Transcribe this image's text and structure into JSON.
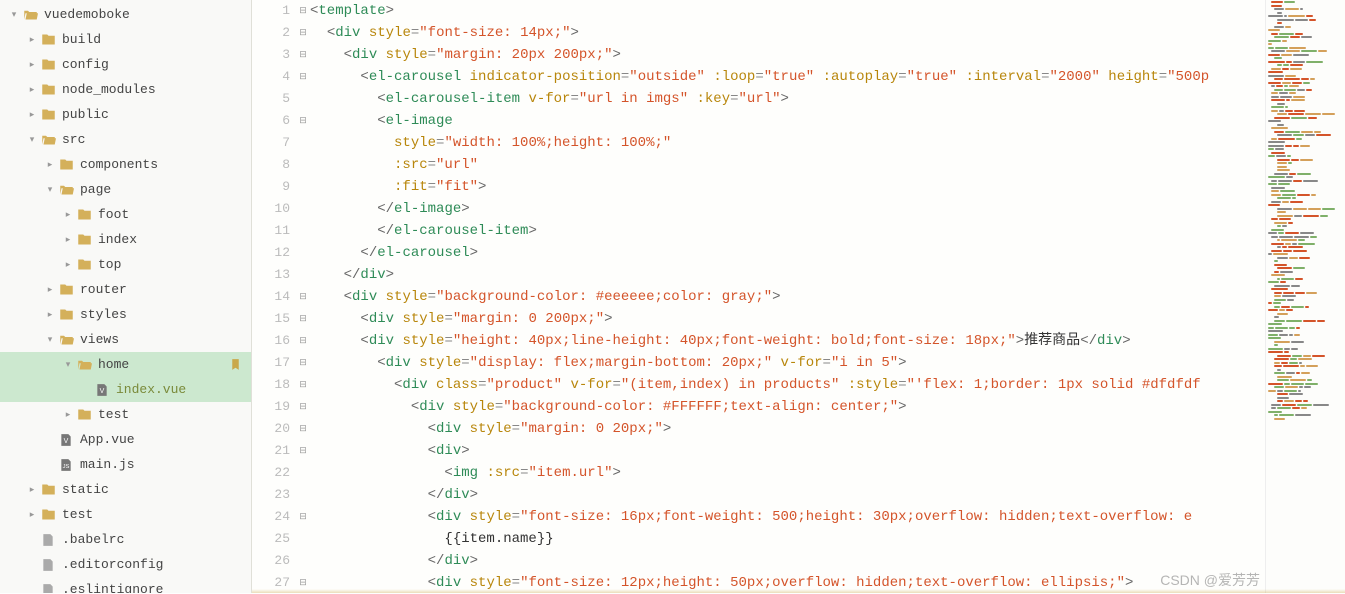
{
  "tree": [
    {
      "depth": 0,
      "chev": "down",
      "icon": "folder-open",
      "label": "vuedemoboke"
    },
    {
      "depth": 1,
      "chev": "right",
      "icon": "folder",
      "label": "build"
    },
    {
      "depth": 1,
      "chev": "right",
      "icon": "folder",
      "label": "config"
    },
    {
      "depth": 1,
      "chev": "right",
      "icon": "folder",
      "label": "node_modules"
    },
    {
      "depth": 1,
      "chev": "right",
      "icon": "folder",
      "label": "public"
    },
    {
      "depth": 1,
      "chev": "down",
      "icon": "folder-open",
      "label": "src"
    },
    {
      "depth": 2,
      "chev": "right",
      "icon": "folder",
      "label": "components"
    },
    {
      "depth": 2,
      "chev": "down",
      "icon": "folder-open",
      "label": "page"
    },
    {
      "depth": 3,
      "chev": "right",
      "icon": "folder",
      "label": "foot"
    },
    {
      "depth": 3,
      "chev": "right",
      "icon": "folder",
      "label": "index"
    },
    {
      "depth": 3,
      "chev": "right",
      "icon": "folder",
      "label": "top"
    },
    {
      "depth": 2,
      "chev": "right",
      "icon": "folder",
      "label": "router"
    },
    {
      "depth": 2,
      "chev": "right",
      "icon": "folder",
      "label": "styles"
    },
    {
      "depth": 2,
      "chev": "down",
      "icon": "folder-open",
      "label": "views"
    },
    {
      "depth": 3,
      "chev": "down",
      "icon": "folder-open",
      "label": "home",
      "mark": true,
      "selected": true
    },
    {
      "depth": 4,
      "chev": "",
      "icon": "file-v",
      "label": "index.vue",
      "selected": true,
      "filelabel": true
    },
    {
      "depth": 3,
      "chev": "right",
      "icon": "folder",
      "label": "test"
    },
    {
      "depth": 2,
      "chev": "",
      "icon": "file-v",
      "label": "App.vue"
    },
    {
      "depth": 2,
      "chev": "",
      "icon": "file-js",
      "label": "main.js"
    },
    {
      "depth": 1,
      "chev": "right",
      "icon": "folder",
      "label": "static"
    },
    {
      "depth": 1,
      "chev": "right",
      "icon": "folder",
      "label": "test"
    },
    {
      "depth": 1,
      "chev": "",
      "icon": "file-g",
      "label": ".babelrc"
    },
    {
      "depth": 1,
      "chev": "",
      "icon": "file-g",
      "label": ".editorconfig"
    },
    {
      "depth": 1,
      "chev": "",
      "icon": "file-g",
      "label": ".eslintignore"
    }
  ],
  "lines": [
    {
      "n": 1,
      "fold": "minus",
      "tokens": [
        [
          "punc",
          "<"
        ],
        [
          "tag",
          "template"
        ],
        [
          "punc",
          ">"
        ]
      ]
    },
    {
      "n": 2,
      "fold": "minus",
      "tokens": [
        [
          "txt",
          "  "
        ],
        [
          "punc",
          "<"
        ],
        [
          "tag",
          "div"
        ],
        [
          "txt",
          " "
        ],
        [
          "attr",
          "style"
        ],
        [
          "op",
          "="
        ],
        [
          "str",
          "\"font-size: 14px;\""
        ],
        [
          "punc",
          ">"
        ]
      ]
    },
    {
      "n": 3,
      "fold": "minus",
      "tokens": [
        [
          "txt",
          "    "
        ],
        [
          "punc",
          "<"
        ],
        [
          "tag",
          "div"
        ],
        [
          "txt",
          " "
        ],
        [
          "attr",
          "style"
        ],
        [
          "op",
          "="
        ],
        [
          "str",
          "\"margin: 20px 200px;\""
        ],
        [
          "punc",
          ">"
        ]
      ]
    },
    {
      "n": 4,
      "fold": "minus",
      "tokens": [
        [
          "txt",
          "      "
        ],
        [
          "punc",
          "<"
        ],
        [
          "tag",
          "el-carousel"
        ],
        [
          "txt",
          " "
        ],
        [
          "attr",
          "indicator-position"
        ],
        [
          "op",
          "="
        ],
        [
          "str",
          "\"outside\""
        ],
        [
          "txt",
          " "
        ],
        [
          "attr",
          ":loop"
        ],
        [
          "op",
          "="
        ],
        [
          "str",
          "\"true\""
        ],
        [
          "txt",
          " "
        ],
        [
          "attr",
          ":autoplay"
        ],
        [
          "op",
          "="
        ],
        [
          "str",
          "\"true\""
        ],
        [
          "txt",
          " "
        ],
        [
          "attr",
          ":interval"
        ],
        [
          "op",
          "="
        ],
        [
          "str",
          "\"2000\""
        ],
        [
          "txt",
          " "
        ],
        [
          "attr",
          "height"
        ],
        [
          "op",
          "="
        ],
        [
          "str",
          "\"500p"
        ]
      ]
    },
    {
      "n": 5,
      "fold": "",
      "tokens": [
        [
          "txt",
          "        "
        ],
        [
          "punc",
          "<"
        ],
        [
          "tag",
          "el-carousel-item"
        ],
        [
          "txt",
          " "
        ],
        [
          "attr",
          "v-for"
        ],
        [
          "op",
          "="
        ],
        [
          "str",
          "\"url in imgs\""
        ],
        [
          "txt",
          " "
        ],
        [
          "attr",
          ":key"
        ],
        [
          "op",
          "="
        ],
        [
          "str",
          "\"url\""
        ],
        [
          "punc",
          ">"
        ]
      ]
    },
    {
      "n": 6,
      "fold": "minus",
      "tokens": [
        [
          "txt",
          "        "
        ],
        [
          "punc",
          "<"
        ],
        [
          "tag",
          "el-image"
        ]
      ]
    },
    {
      "n": 7,
      "fold": "",
      "tokens": [
        [
          "txt",
          "          "
        ],
        [
          "attr",
          "style"
        ],
        [
          "op",
          "="
        ],
        [
          "str",
          "\"width: 100%;height: 100%;\""
        ]
      ]
    },
    {
      "n": 8,
      "fold": "",
      "tokens": [
        [
          "txt",
          "          "
        ],
        [
          "attr",
          ":src"
        ],
        [
          "op",
          "="
        ],
        [
          "str",
          "\"url\""
        ]
      ]
    },
    {
      "n": 9,
      "fold": "",
      "tokens": [
        [
          "txt",
          "          "
        ],
        [
          "attr",
          ":fit"
        ],
        [
          "op",
          "="
        ],
        [
          "str",
          "\"fit\""
        ],
        [
          "punc",
          ">"
        ]
      ]
    },
    {
      "n": 10,
      "fold": "",
      "tokens": [
        [
          "txt",
          "        "
        ],
        [
          "punc",
          "</"
        ],
        [
          "tag",
          "el-image"
        ],
        [
          "punc",
          ">"
        ]
      ]
    },
    {
      "n": 11,
      "fold": "",
      "tokens": [
        [
          "txt",
          "        "
        ],
        [
          "punc",
          "</"
        ],
        [
          "tag",
          "el-carousel-item"
        ],
        [
          "punc",
          ">"
        ]
      ]
    },
    {
      "n": 12,
      "fold": "",
      "tokens": [
        [
          "txt",
          "      "
        ],
        [
          "punc",
          "</"
        ],
        [
          "tag",
          "el-carousel"
        ],
        [
          "punc",
          ">"
        ]
      ]
    },
    {
      "n": 13,
      "fold": "",
      "tokens": [
        [
          "txt",
          "    "
        ],
        [
          "punc",
          "</"
        ],
        [
          "tag",
          "div"
        ],
        [
          "punc",
          ">"
        ]
      ]
    },
    {
      "n": 14,
      "fold": "minus",
      "tokens": [
        [
          "txt",
          "    "
        ],
        [
          "punc",
          "<"
        ],
        [
          "tag",
          "div"
        ],
        [
          "txt",
          " "
        ],
        [
          "attr",
          "style"
        ],
        [
          "op",
          "="
        ],
        [
          "str",
          "\"background-color: #eeeeee;color: gray;\""
        ],
        [
          "punc",
          ">"
        ]
      ]
    },
    {
      "n": 15,
      "fold": "minus",
      "tokens": [
        [
          "txt",
          "      "
        ],
        [
          "punc",
          "<"
        ],
        [
          "tag",
          "div"
        ],
        [
          "txt",
          " "
        ],
        [
          "attr",
          "style"
        ],
        [
          "op",
          "="
        ],
        [
          "str",
          "\"margin: 0 200px;\""
        ],
        [
          "punc",
          ">"
        ]
      ]
    },
    {
      "n": 16,
      "fold": "minus",
      "tokens": [
        [
          "txt",
          "      "
        ],
        [
          "punc",
          "<"
        ],
        [
          "tag",
          "div"
        ],
        [
          "txt",
          " "
        ],
        [
          "attr",
          "style"
        ],
        [
          "op",
          "="
        ],
        [
          "str",
          "\"height: 40px;line-height: 40px;font-weight: bold;font-size: 18px;\""
        ],
        [
          "punc",
          ">"
        ],
        [
          "txt",
          "推荐商品"
        ],
        [
          "punc",
          "</"
        ],
        [
          "tag",
          "div"
        ],
        [
          "punc",
          ">"
        ]
      ]
    },
    {
      "n": 17,
      "fold": "minus",
      "tokens": [
        [
          "txt",
          "        "
        ],
        [
          "punc",
          "<"
        ],
        [
          "tag",
          "div"
        ],
        [
          "txt",
          " "
        ],
        [
          "attr",
          "style"
        ],
        [
          "op",
          "="
        ],
        [
          "str",
          "\"display: flex;margin-bottom: 20px;\""
        ],
        [
          "txt",
          " "
        ],
        [
          "attr",
          "v-for"
        ],
        [
          "op",
          "="
        ],
        [
          "str",
          "\"i in 5\""
        ],
        [
          "punc",
          ">"
        ]
      ]
    },
    {
      "n": 18,
      "fold": "minus",
      "tokens": [
        [
          "txt",
          "          "
        ],
        [
          "punc",
          "<"
        ],
        [
          "tag",
          "div"
        ],
        [
          "txt",
          " "
        ],
        [
          "attr",
          "class"
        ],
        [
          "op",
          "="
        ],
        [
          "str",
          "\"product\""
        ],
        [
          "txt",
          " "
        ],
        [
          "attr",
          "v-for"
        ],
        [
          "op",
          "="
        ],
        [
          "str",
          "\"(item,index) in products\""
        ],
        [
          "txt",
          " "
        ],
        [
          "attr",
          ":style"
        ],
        [
          "op",
          "="
        ],
        [
          "str",
          "\"'flex: 1;border: 1px solid #dfdfdf"
        ]
      ]
    },
    {
      "n": 19,
      "fold": "minus",
      "tokens": [
        [
          "txt",
          "            "
        ],
        [
          "punc",
          "<"
        ],
        [
          "tag",
          "div"
        ],
        [
          "txt",
          " "
        ],
        [
          "attr",
          "style"
        ],
        [
          "op",
          "="
        ],
        [
          "str",
          "\"background-color: #FFFFFF;text-align: center;\""
        ],
        [
          "punc",
          ">"
        ]
      ]
    },
    {
      "n": 20,
      "fold": "minus",
      "tokens": [
        [
          "txt",
          "              "
        ],
        [
          "punc",
          "<"
        ],
        [
          "tag",
          "div"
        ],
        [
          "txt",
          " "
        ],
        [
          "attr",
          "style"
        ],
        [
          "op",
          "="
        ],
        [
          "str",
          "\"margin: 0 20px;\""
        ],
        [
          "punc",
          ">"
        ]
      ]
    },
    {
      "n": 21,
      "fold": "minus",
      "tokens": [
        [
          "txt",
          "              "
        ],
        [
          "punc",
          "<"
        ],
        [
          "tag",
          "div"
        ],
        [
          "punc",
          ">"
        ]
      ]
    },
    {
      "n": 22,
      "fold": "",
      "tokens": [
        [
          "txt",
          "                "
        ],
        [
          "punc",
          "<"
        ],
        [
          "tag",
          "img"
        ],
        [
          "txt",
          " "
        ],
        [
          "attr",
          ":src"
        ],
        [
          "op",
          "="
        ],
        [
          "str",
          "\"item.url\""
        ],
        [
          "punc",
          ">"
        ]
      ]
    },
    {
      "n": 23,
      "fold": "",
      "tokens": [
        [
          "txt",
          "              "
        ],
        [
          "punc",
          "</"
        ],
        [
          "tag",
          "div"
        ],
        [
          "punc",
          ">"
        ]
      ]
    },
    {
      "n": 24,
      "fold": "minus",
      "tokens": [
        [
          "txt",
          "              "
        ],
        [
          "punc",
          "<"
        ],
        [
          "tag",
          "div"
        ],
        [
          "txt",
          " "
        ],
        [
          "attr",
          "style"
        ],
        [
          "op",
          "="
        ],
        [
          "str",
          "\"font-size: 16px;font-weight: 500;height: 30px;overflow: hidden;text-overflow: e"
        ]
      ]
    },
    {
      "n": 25,
      "fold": "",
      "tokens": [
        [
          "txt",
          "                "
        ],
        [
          "txt",
          "{{item.name}}"
        ]
      ]
    },
    {
      "n": 26,
      "fold": "",
      "tokens": [
        [
          "txt",
          "              "
        ],
        [
          "punc",
          "</"
        ],
        [
          "tag",
          "div"
        ],
        [
          "punc",
          ">"
        ]
      ]
    },
    {
      "n": 27,
      "fold": "minus",
      "tokens": [
        [
          "txt",
          "              "
        ],
        [
          "punc",
          "<"
        ],
        [
          "tag",
          "div"
        ],
        [
          "txt",
          " "
        ],
        [
          "attr",
          "style"
        ],
        [
          "op",
          "="
        ],
        [
          "str",
          "\"font-size: 12px;height: 50px;overflow: hidden;text-overflow: ellipsis;\""
        ],
        [
          "punc",
          ">"
        ]
      ]
    }
  ],
  "watermark": "CSDN @爱芳芳"
}
